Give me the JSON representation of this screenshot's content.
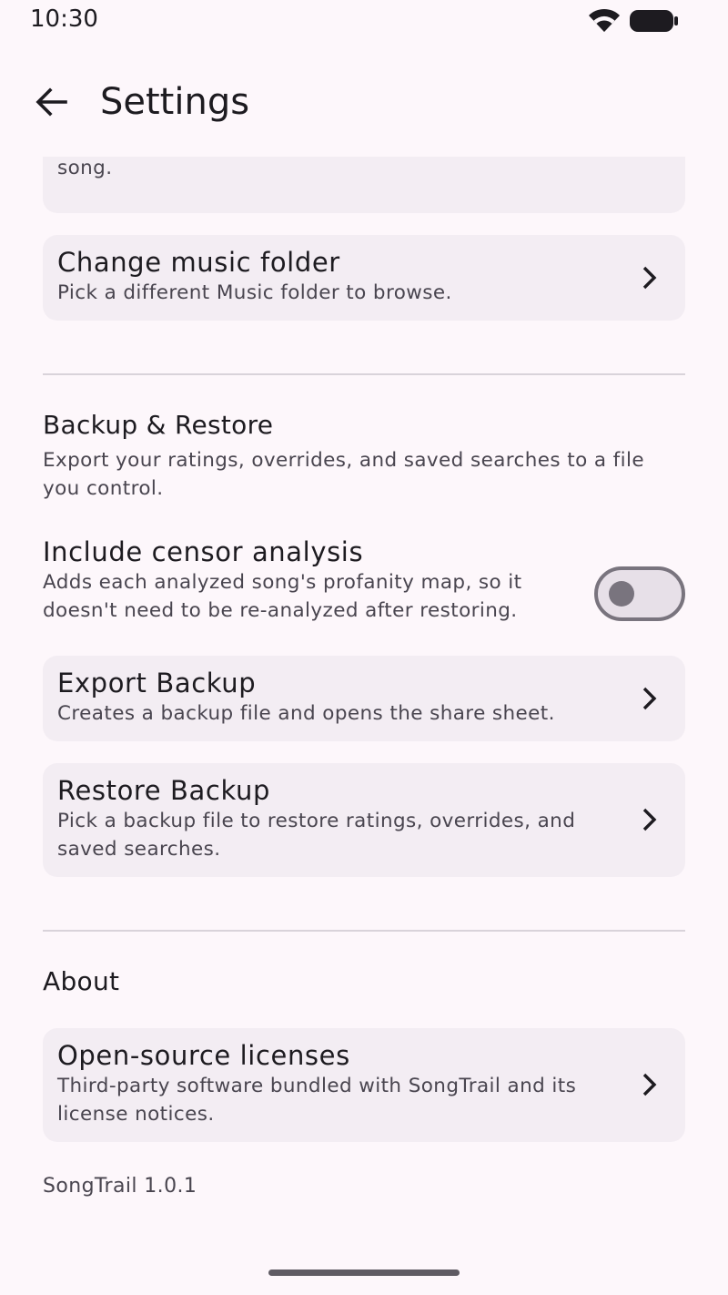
{
  "status_bar": {
    "time": "10:30",
    "wifi_icon": "wifi-icon",
    "battery_icon": "battery-icon"
  },
  "header": {
    "back_icon": "arrow-back-icon",
    "title": "Settings"
  },
  "library": {
    "rescan_subtitle": "Rebuild the index and re-read tags and art for every song.",
    "change_folder": {
      "title": "Change music folder",
      "subtitle": "Pick a different Music folder to browse."
    }
  },
  "backup": {
    "title": "Backup & Restore",
    "description": "Export your ratings, overrides, and saved searches to a file you control.",
    "censor_toggle": {
      "title": "Include censor analysis",
      "subtitle": "Adds each analyzed song's profanity map, so it doesn't need to be re-analyzed after restoring.",
      "enabled": false
    },
    "export": {
      "title": "Export Backup",
      "subtitle": "Creates a backup file and opens the share sheet."
    },
    "restore": {
      "title": "Restore Backup",
      "subtitle": "Pick a backup file to restore ratings, overrides, and saved searches."
    }
  },
  "about": {
    "title": "About",
    "licenses": {
      "title": "Open-source licenses",
      "subtitle": "Third-party software bundled with SongTrail and its license notices."
    },
    "version": "SongTrail 1.0.1"
  },
  "colors": {
    "background": "#fdf7fb",
    "card": "#f3edf3",
    "text_primary": "#1d1b20",
    "text_secondary": "#49454f",
    "switch_outline": "#79747e"
  }
}
